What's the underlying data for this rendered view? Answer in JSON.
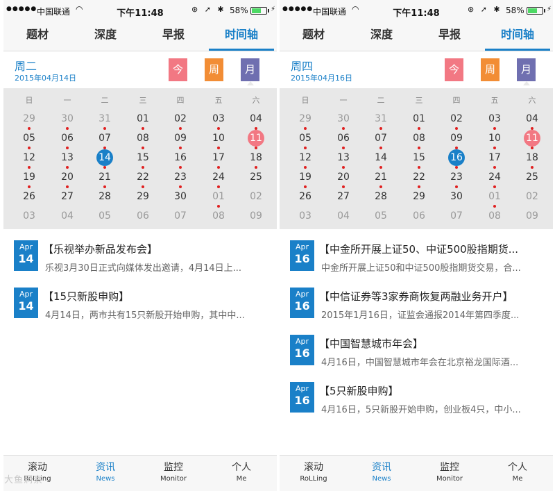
{
  "status_bar": {
    "signal": "●●●●●",
    "carrier": "中国联通",
    "time": "下午11:48",
    "status_icons": "⊛ ➚ ✱",
    "battery": "58%",
    "battery_level": 0.58
  },
  "top_tabs": [
    "题材",
    "深度",
    "早报",
    "时间轴"
  ],
  "active_top_tab": 3,
  "mode_buttons": {
    "today": "今",
    "week": "周",
    "month": "月"
  },
  "weekday_headers": [
    "日",
    "一",
    "二",
    "三",
    "四",
    "五",
    "六"
  ],
  "calendar_days": [
    [
      "29",
      "30",
      "31",
      "01",
      "02",
      "03",
      "04"
    ],
    [
      "05",
      "06",
      "07",
      "08",
      "09",
      "10",
      "11"
    ],
    [
      "12",
      "13",
      "14",
      "15",
      "16",
      "17",
      "18"
    ],
    [
      "19",
      "20",
      "21",
      "22",
      "23",
      "24",
      "25"
    ],
    [
      "26",
      "27",
      "28",
      "29",
      "30",
      "01",
      "02"
    ],
    [
      "03",
      "04",
      "05",
      "06",
      "07",
      "08",
      "09"
    ]
  ],
  "bottom_tabs": [
    {
      "cn": "滚动",
      "en": "RoLLing"
    },
    {
      "cn": "资讯",
      "en": "News"
    },
    {
      "cn": "监控",
      "en": "Monitor"
    },
    {
      "cn": "个人",
      "en": "Me"
    }
  ],
  "active_bottom_tab": 1,
  "watermark": "大鱼洞察",
  "screens": [
    {
      "weekday": "周二",
      "full_date": "2015年04月14日",
      "selected_day": "14",
      "news": [
        {
          "month": "Apr",
          "day": "14",
          "headline": "【乐视举办新品发布会】",
          "summary": "乐视3月30日正式向媒体发出邀请，4月14日上..."
        },
        {
          "month": "Apr",
          "day": "14",
          "headline": "【15只新股申购】",
          "summary": "4月14日，两市共有15只新股开始申购，其中中..."
        }
      ]
    },
    {
      "weekday": "周四",
      "full_date": "2015年04月16日",
      "selected_day": "16",
      "news": [
        {
          "month": "Apr",
          "day": "16",
          "headline": "【中金所开展上证50、中证500股指期货...",
          "summary": "中金所开展上证50和中证500股指期货交易，合..."
        },
        {
          "month": "Apr",
          "day": "16",
          "headline": "【中信证券等3家券商恢复两融业务开户】",
          "summary": "2015年1月16日，证监会通报2014年第四季度..."
        },
        {
          "month": "Apr",
          "day": "16",
          "headline": "【中国智慧城市年会】",
          "summary": "4月16日，中国智慧城市年会在北京裕龙国际酒..."
        },
        {
          "month": "Apr",
          "day": "16",
          "headline": "【5只新股申购】",
          "summary": "4月16日，5只新股开始申购，创业板4只，中小..."
        }
      ]
    }
  ],
  "colors": {
    "accent": "#1a80c8",
    "today_button": "#f27883",
    "week_button": "#f28d35",
    "month_button": "#6f6fb0",
    "event_dot": "#e02020"
  }
}
